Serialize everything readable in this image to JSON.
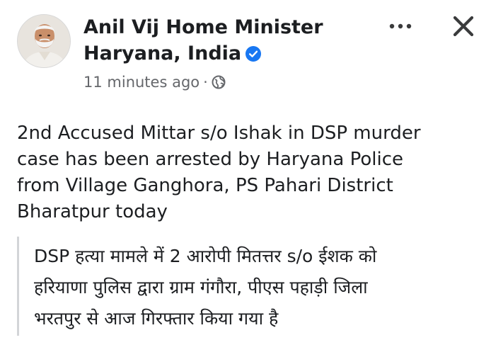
{
  "post": {
    "author": {
      "name_line1": "Anil Vij Home Minister",
      "name_line2": "Haryana, India",
      "verified": true,
      "avatar_icon": "profile-photo"
    },
    "timestamp": "11 minutes ago",
    "separator": "·",
    "audience_icon": "globe-icon",
    "body_lines": [
      "2nd Accused Mittar s/o Ishak in DSP murder",
      "case has been arrested by Haryana Police",
      "from Village Ganghora, PS Pahari District",
      "Bharatpur today"
    ],
    "quote_lines": [
      "DSP हत्या मामले में 2 आरोपी मितत्तर s/o ईशक को",
      "हरियाणा पुलिस द्वारा ग्राम गंगौरा, पीएस पहाड़ी जिला",
      "भरतपुर से आज गिरफ्तार किया गया है"
    ]
  },
  "actions": {
    "more_icon": "more-options-icon",
    "close_icon": "close-icon"
  },
  "colors": {
    "text": "#1c1e21",
    "meta": "#65676b",
    "verified": "#1877f2",
    "quote_bar": "#d3d5d8",
    "icon": "#3a3b3c"
  }
}
